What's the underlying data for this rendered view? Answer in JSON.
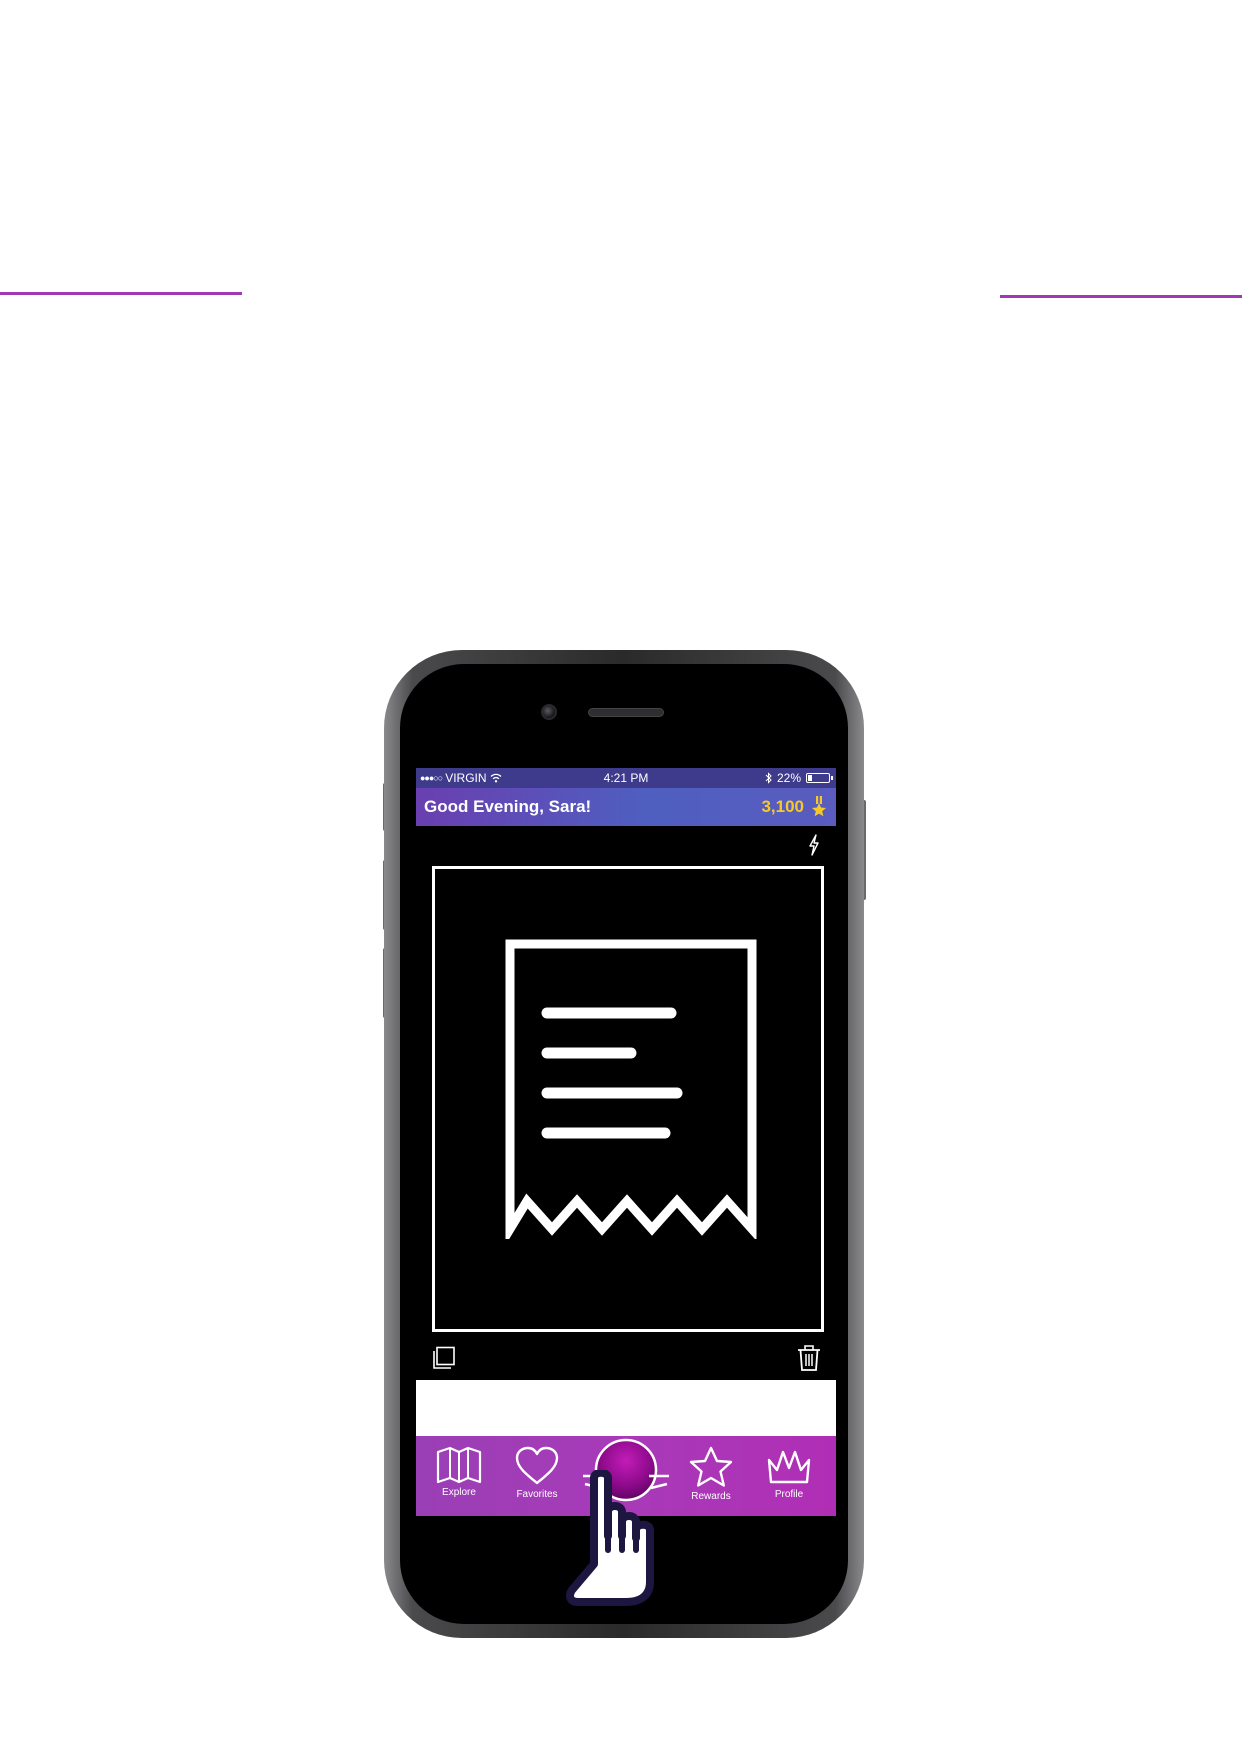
{
  "colors": {
    "accent": "#a03ab4",
    "header_start": "#6a3fb0",
    "header_end": "#5a5cbf",
    "points": "#f5c92a",
    "tab_bar": "#a83ab8"
  },
  "status_bar": {
    "carrier": "VIRGIN",
    "time": "4:21 PM",
    "battery": "22%",
    "battery_level": 0.22
  },
  "header": {
    "greeting": "Good Evening, Sara!",
    "points": "3,100",
    "points_icon": "star-medal-icon"
  },
  "camera": {
    "flash_icon": "flash-icon",
    "placeholder_icon": "receipt-icon",
    "gallery_icon": "gallery-icon",
    "delete_icon": "trash-icon"
  },
  "tabs": [
    {
      "label": "Explore",
      "icon": "map-icon"
    },
    {
      "label": "Favorites",
      "icon": "heart-icon"
    },
    {
      "label": "",
      "icon": "scan-icon"
    },
    {
      "label": "Rewards",
      "icon": "star-icon"
    },
    {
      "label": "Profile",
      "icon": "crown-icon"
    }
  ]
}
